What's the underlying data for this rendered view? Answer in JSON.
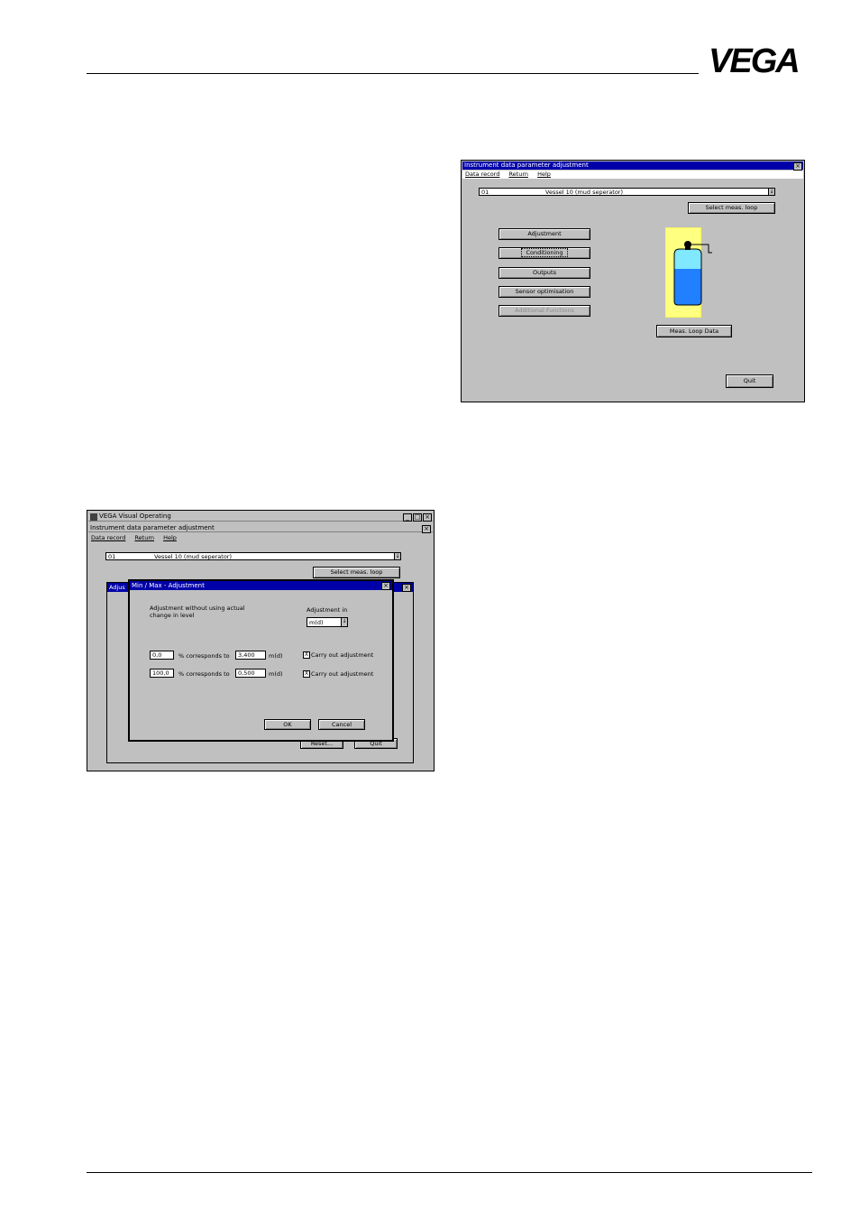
{
  "header": {
    "logo_text": "VEGA"
  },
  "screenshot_top": {
    "window_title": "Instrument data parameter adjustment",
    "menu": [
      "Data record",
      "Return",
      "Help"
    ],
    "loop_number": "01",
    "loop_name": "Vessel 10   (mud seperator)",
    "select_loop_button": "Select meas. loop",
    "buttons": [
      "Adjustment",
      "Conditioning",
      "Outputs",
      "Sensor optimisation",
      "Additional Functions"
    ],
    "meas_loop_data_button": "Meas. Loop Data",
    "quit_button": "Quit",
    "colors": {
      "vessel_bg": "#ffff80",
      "liquid": "#2080ff",
      "gas": "#80e8ff"
    }
  },
  "screenshot_bottom": {
    "app_title": "VEGA Visual Operating",
    "window_title": "Instrument data parameter adjustment",
    "menu": [
      "Data record",
      "Return",
      "Help"
    ],
    "loop_number": "01",
    "loop_name": "Vessel 10   (mud seperator)",
    "select_loop_button": "Select meas. loop",
    "background_panel_label": "Adjus",
    "reset_button": "Reset...",
    "quit_button": "Quit",
    "dialog": {
      "title": "Min / Max - Adjustment",
      "description": "Adjustment without using actual\nchange in level",
      "adjustment_in_label": "Adjustment in",
      "unit_value": "m(d)",
      "rows": [
        {
          "percent": "0,0",
          "corresponds": "% corresponds to",
          "value": "3,400",
          "unit": "m(d)",
          "checkbox_mark": "X",
          "check_label": "Carry out adjustment"
        },
        {
          "percent": "100,0",
          "corresponds": "% corresponds to",
          "value": "0,500",
          "unit": "m(d)",
          "checkbox_mark": "X",
          "check_label": "Carry out adjustment"
        }
      ],
      "ok_button": "OK",
      "cancel_button": "Cancel"
    }
  }
}
